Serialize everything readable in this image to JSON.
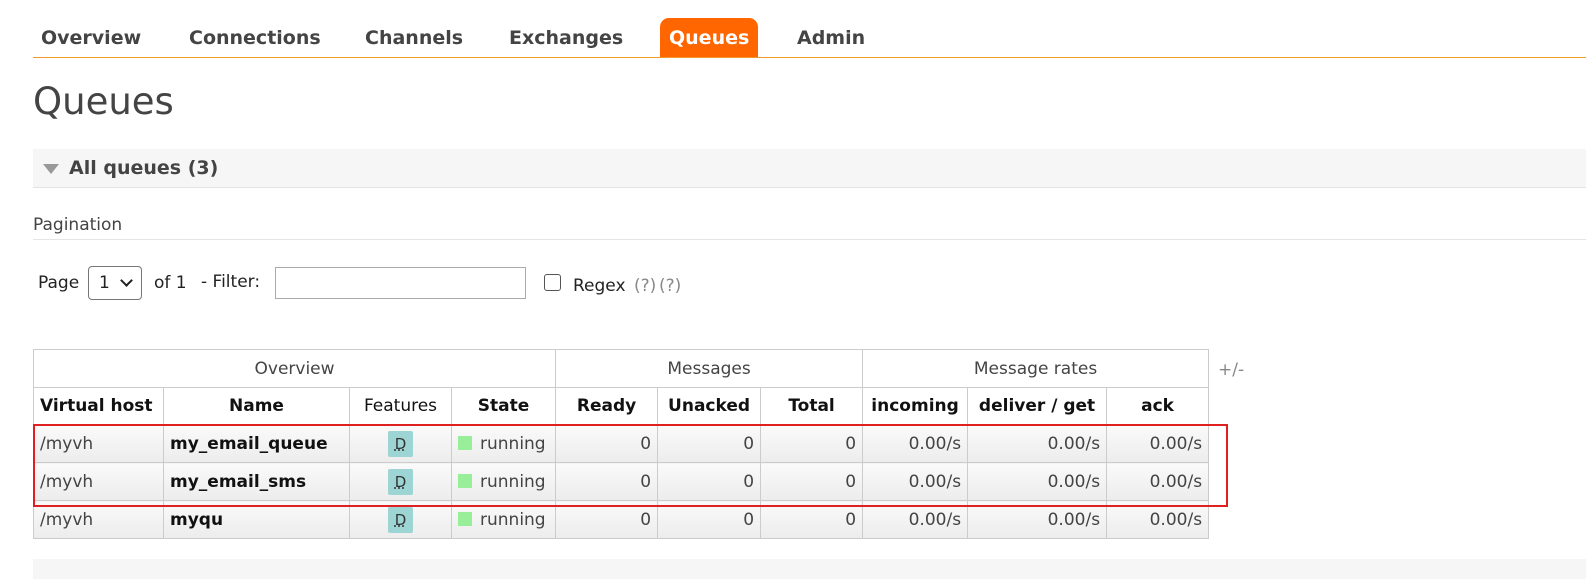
{
  "nav": {
    "tabs": [
      "Overview",
      "Connections",
      "Channels",
      "Exchanges",
      "Queues",
      "Admin"
    ],
    "active": "Queues"
  },
  "page_title": "Queues",
  "section": {
    "title": "All queues (3)"
  },
  "pagination": {
    "label": "Pagination",
    "page_label": "Page",
    "page_value": "1",
    "of_label": "of 1",
    "filter_label": "- Filter:",
    "filter_value": "",
    "regex_label": "Regex",
    "help1": "(?)",
    "help2": "(?)"
  },
  "table": {
    "groups": [
      "Overview",
      "Messages",
      "Message rates"
    ],
    "columns": [
      "Virtual host",
      "Name",
      "Features",
      "State",
      "Ready",
      "Unacked",
      "Total",
      "incoming",
      "deliver / get",
      "ack"
    ],
    "plus_minus": "+/-",
    "rows": [
      {
        "vhost": "/myvh",
        "name": "my_email_queue",
        "feature": "D",
        "state": "running",
        "ready": "0",
        "unacked": "0",
        "total": "0",
        "incoming": "0.00/s",
        "deliver": "0.00/s",
        "ack": "0.00/s"
      },
      {
        "vhost": "/myvh",
        "name": "my_email_sms",
        "feature": "D",
        "state": "running",
        "ready": "0",
        "unacked": "0",
        "total": "0",
        "incoming": "0.00/s",
        "deliver": "0.00/s",
        "ack": "0.00/s"
      },
      {
        "vhost": "/myvh",
        "name": "myqu",
        "feature": "D",
        "state": "running",
        "ready": "0",
        "unacked": "0",
        "total": "0",
        "incoming": "0.00/s",
        "deliver": "0.00/s",
        "ack": "0.00/s"
      }
    ]
  },
  "colors": {
    "accent": "#ff6600",
    "state_running": "#99ee99",
    "feature_badge": "#9cd5d4",
    "highlight": "#e02020"
  }
}
